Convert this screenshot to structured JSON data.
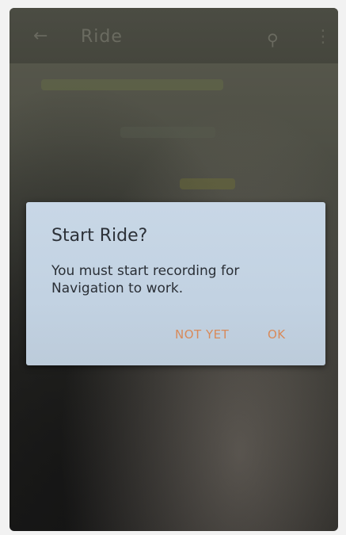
{
  "background_app": {
    "title": "Ride",
    "icons": [
      "back-arrow-icon",
      "bike-icon",
      "overflow-menu-icon"
    ]
  },
  "dialog": {
    "title": "Start Ride?",
    "message": "You must start recording for Navigation to work.",
    "buttons": {
      "not_yet": "NOT YET",
      "ok": "OK"
    }
  },
  "colors": {
    "dialog_background": "#c2d2e2",
    "button_text": "#d88a5a",
    "title_text": "#2c3138"
  }
}
